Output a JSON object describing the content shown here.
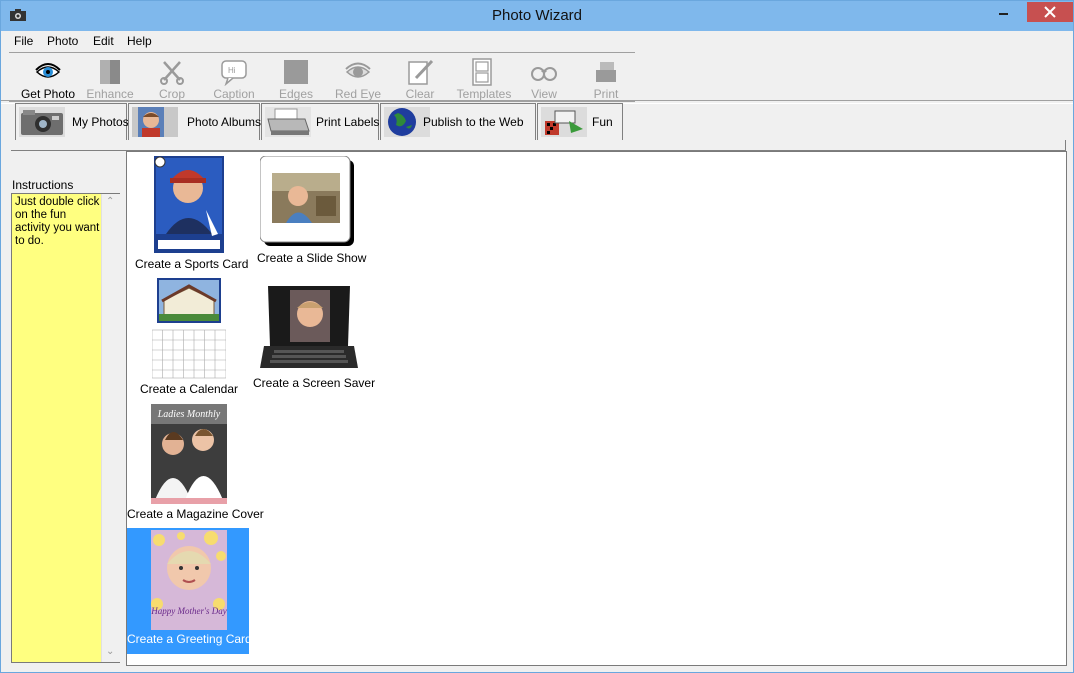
{
  "window": {
    "title": "Photo Wizard"
  },
  "menu": {
    "items": [
      "File",
      "Photo",
      "Edit",
      "Help"
    ]
  },
  "toolbar": {
    "tools": [
      {
        "label": "Get Photo",
        "icon": "eye-icon",
        "enabled": true
      },
      {
        "label": "Enhance",
        "icon": "enhance-icon",
        "enabled": false
      },
      {
        "label": "Crop",
        "icon": "scissors-icon",
        "enabled": false
      },
      {
        "label": "Caption",
        "icon": "speech-bubble-icon",
        "enabled": false
      },
      {
        "label": "Edges",
        "icon": "edges-icon",
        "enabled": false
      },
      {
        "label": "Red Eye",
        "icon": "red-eye-icon",
        "enabled": false
      },
      {
        "label": "Clear",
        "icon": "clear-icon",
        "enabled": false
      },
      {
        "label": "Templates",
        "icon": "templates-icon",
        "enabled": false
      },
      {
        "label": "View",
        "icon": "glasses-icon",
        "enabled": false
      },
      {
        "label": "Print",
        "icon": "printer-icon",
        "enabled": false
      }
    ]
  },
  "tabs": [
    {
      "label": "My Photos",
      "icon": "camera-icon"
    },
    {
      "label": "Photo Albums",
      "icon": "portrait-icon"
    },
    {
      "label": "Print Labels",
      "icon": "printer-icon"
    },
    {
      "label": "Publish to the Web",
      "icon": "globe-icon"
    },
    {
      "label": "Fun",
      "icon": "fun-icon"
    }
  ],
  "instructions": {
    "title": "Instructions",
    "text": "Just double click on the fun activity you want to do."
  },
  "activities": [
    {
      "label": "Create a Sports Card",
      "selected": false
    },
    {
      "label": "Create a Slide Show",
      "selected": false
    },
    {
      "label": "Create a Calendar",
      "selected": false
    },
    {
      "label": "Create a Screen Saver",
      "selected": false
    },
    {
      "label": "Create a Magazine Cover",
      "selected": false,
      "cover_title": "Ladies Monthly"
    },
    {
      "label": "Create a Greeting Card",
      "selected": true,
      "card_text": "Happy Mother's Day"
    }
  ],
  "colors": {
    "titlebar": "#7fb8ec",
    "close_button": "#c75050",
    "instructions_bg": "#ffff80",
    "selection": "#3399ff"
  }
}
